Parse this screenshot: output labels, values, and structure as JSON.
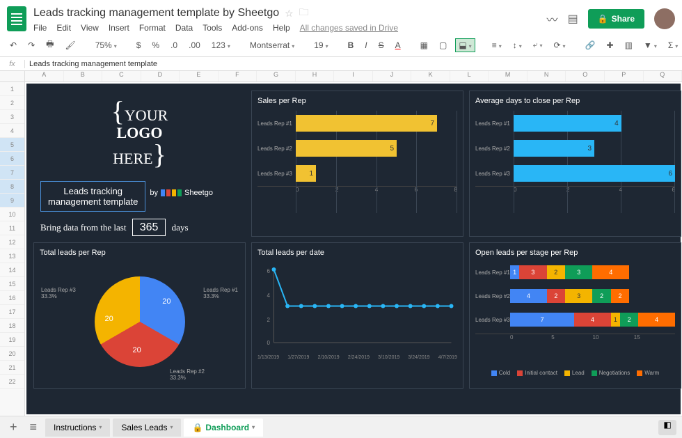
{
  "doc_title": "Leads tracking management template by Sheetgo",
  "menus": [
    "File",
    "Edit",
    "View",
    "Insert",
    "Format",
    "Data",
    "Tools",
    "Add-ons",
    "Help"
  ],
  "saved_msg": "All changes saved in Drive",
  "share_label": "Share",
  "zoom": "75%",
  "font_name": "Montserrat",
  "font_size": "19",
  "more_fmt": "123",
  "fx_content": "Leads tracking management template",
  "col_headers": [
    "A",
    "B",
    "C",
    "D",
    "E",
    "F",
    "G",
    "H",
    "I",
    "J",
    "K",
    "L",
    "M",
    "N",
    "O",
    "P",
    "Q"
  ],
  "row_headers": [
    "1",
    "2",
    "3",
    "4",
    "5",
    "6",
    "7",
    "8",
    "9",
    "10",
    "11",
    "12",
    "13",
    "14",
    "15",
    "16",
    "17",
    "18",
    "19",
    "20",
    "21",
    "22"
  ],
  "logo": {
    "l1": "YOUR",
    "l2": "LOGO",
    "l3": "HERE"
  },
  "template_title_l1": "Leads tracking",
  "template_title_l2": "management template",
  "by": "by",
  "sheetgo": "Sheetgo",
  "bring_prefix": "Bring data from the last",
  "days_value": "365",
  "days_suffix": "days",
  "panels": {
    "sales": "Sales per Rep",
    "avgdays": "Average days to close per Rep",
    "totalleads": "Total leads per Rep",
    "leadsdate": "Total leads per date",
    "openleads": "Open leads per stage per Rep"
  },
  "chart_data": [
    {
      "id": "sales_per_rep",
      "type": "bar",
      "orientation": "horizontal",
      "categories": [
        "Leads Rep #1",
        "Leads Rep #2",
        "Leads Rep #3"
      ],
      "values": [
        7,
        5,
        1
      ],
      "xlim": [
        0,
        8
      ],
      "xticks": [
        0,
        2,
        4,
        6,
        8
      ],
      "color": "#f1c232"
    },
    {
      "id": "avg_days_close",
      "type": "bar",
      "orientation": "horizontal",
      "categories": [
        "Leads Rep #1",
        "Leads Rep #2",
        "Leads Rep #3"
      ],
      "values": [
        4,
        3,
        6
      ],
      "xlim": [
        0,
        6
      ],
      "xticks": [
        0,
        2,
        4,
        6
      ],
      "color": "#29b6f6"
    },
    {
      "id": "total_leads_pie",
      "type": "pie",
      "categories": [
        "Leads Rep #1",
        "Leads Rep #2",
        "Leads Rep #3"
      ],
      "values": [
        20,
        20,
        20
      ],
      "percents": [
        "33.3%",
        "33.3%",
        "33.3%"
      ],
      "colors": [
        "#4285f4",
        "#db4437",
        "#f4b400"
      ]
    },
    {
      "id": "leads_per_date",
      "type": "line",
      "x": [
        "1/13/2019",
        "1/27/2019",
        "2/10/2019",
        "2/24/2019",
        "3/10/2019",
        "3/24/2019",
        "4/7/2019"
      ],
      "values": [
        6,
        3,
        3,
        3,
        3,
        3,
        3,
        3,
        3,
        3,
        3,
        3,
        3,
        3
      ],
      "ylim": [
        0,
        6
      ],
      "yticks": [
        0,
        2,
        4,
        6
      ],
      "color": "#29b6f6"
    },
    {
      "id": "open_leads_stage",
      "type": "bar",
      "stacked": true,
      "orientation": "horizontal",
      "categories": [
        "Leads Rep #1",
        "Leads Rep #2",
        "Leads Rep #3"
      ],
      "series": [
        {
          "name": "Cold",
          "color": "#4285f4",
          "values": [
            1,
            4,
            7
          ]
        },
        {
          "name": "Initial contact",
          "color": "#db4437",
          "values": [
            3,
            2,
            4
          ]
        },
        {
          "name": "Lead",
          "color": "#f4b400",
          "values": [
            2,
            3,
            1
          ]
        },
        {
          "name": "Negotiations",
          "color": "#0f9d58",
          "values": [
            3,
            2,
            2
          ]
        },
        {
          "name": "Warm",
          "color": "#ff6d00",
          "values": [
            4,
            2,
            4
          ]
        }
      ],
      "xticks": [
        0,
        5,
        10,
        15
      ]
    }
  ],
  "tabs": [
    "Instructions",
    "Sales Leads",
    "Dashboard"
  ],
  "active_tab": "Dashboard"
}
